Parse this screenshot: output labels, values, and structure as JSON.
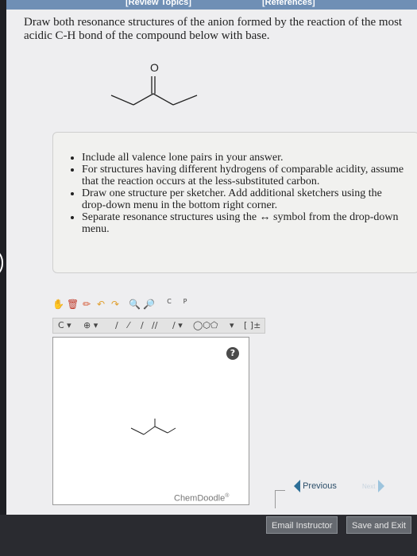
{
  "header": {
    "review_topics": "[Review Topics]",
    "references": "[References]"
  },
  "question": {
    "text": "Draw both resonance structures of the anion formed by the reaction of the most acidic C-H bond of the compound below with base."
  },
  "molecule": {
    "oxygen_label": "O"
  },
  "instructions": {
    "items": [
      "Include all valence lone pairs in your answer.",
      "For structures having different hydrogens of comparable acidity, assume that the reaction occurs at the less-substituted carbon.",
      "Draw one structure per sketcher. Add additional sketchers using the drop-down menu in the bottom right corner.",
      "Separate resonance structures using the ↔ symbol from the drop-down menu."
    ]
  },
  "sketcher": {
    "toolbar_text_c": "C",
    "toolbar_text_p": "P",
    "carbon_label": "C",
    "plus_label": "⊕",
    "bracket_label": "[ ]±",
    "help_label": "?",
    "brand": "ChemDoodle",
    "brand_mark": "®"
  },
  "navigation": {
    "previous": "Previous",
    "next": "Next"
  },
  "footer": {
    "email_instructor": "Email Instructor",
    "save_and_exit": "Save and Exit"
  },
  "colors": {
    "top_bar": "#6f8fb5",
    "nav_arrow": "#2d6f98",
    "next_arrow": "#9dc4dd"
  }
}
